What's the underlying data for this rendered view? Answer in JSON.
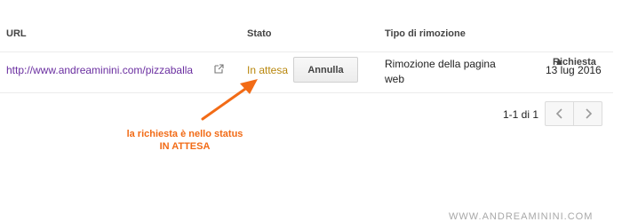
{
  "header": {
    "url": "URL",
    "stato": "Stato",
    "tipo": "Tipo di rimozione",
    "richiesta": "Richiesta",
    "sort_arrow": "▲"
  },
  "row": {
    "url": "http://www.andreaminini.com/pizzaballa",
    "status": "In attesa",
    "cancel_label": "Annulla",
    "tipo": "Rimozione della pagina web",
    "date": "13 lug 2016"
  },
  "pager": {
    "text": "1-1 di 1"
  },
  "annotation": {
    "line1": "la richiesta è nello status",
    "line2": "IN ATTESA"
  },
  "watermark": "WWW.ANDREAMININI.COM",
  "colors": {
    "link": "#6a2ea0",
    "status": "#b8860b",
    "sort_header": "#dd4b39",
    "annotation": "#f26b16"
  }
}
